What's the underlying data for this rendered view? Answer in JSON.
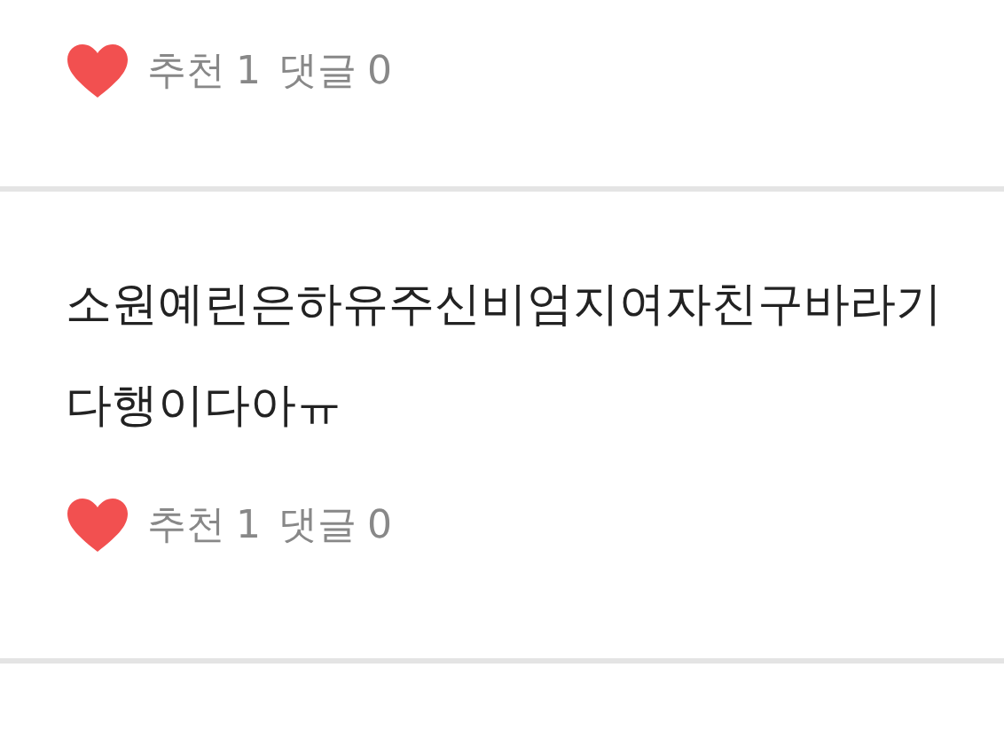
{
  "posts": [
    {
      "likes_label": "추천",
      "likes": "1",
      "comments_label": "댓글",
      "comments": "0"
    },
    {
      "text": "소원예린은하유주신비엄지여자친구바라기다행이다아ㅠ",
      "likes_label": "추천",
      "likes": "1",
      "comments_label": "댓글",
      "comments": "0"
    }
  ]
}
